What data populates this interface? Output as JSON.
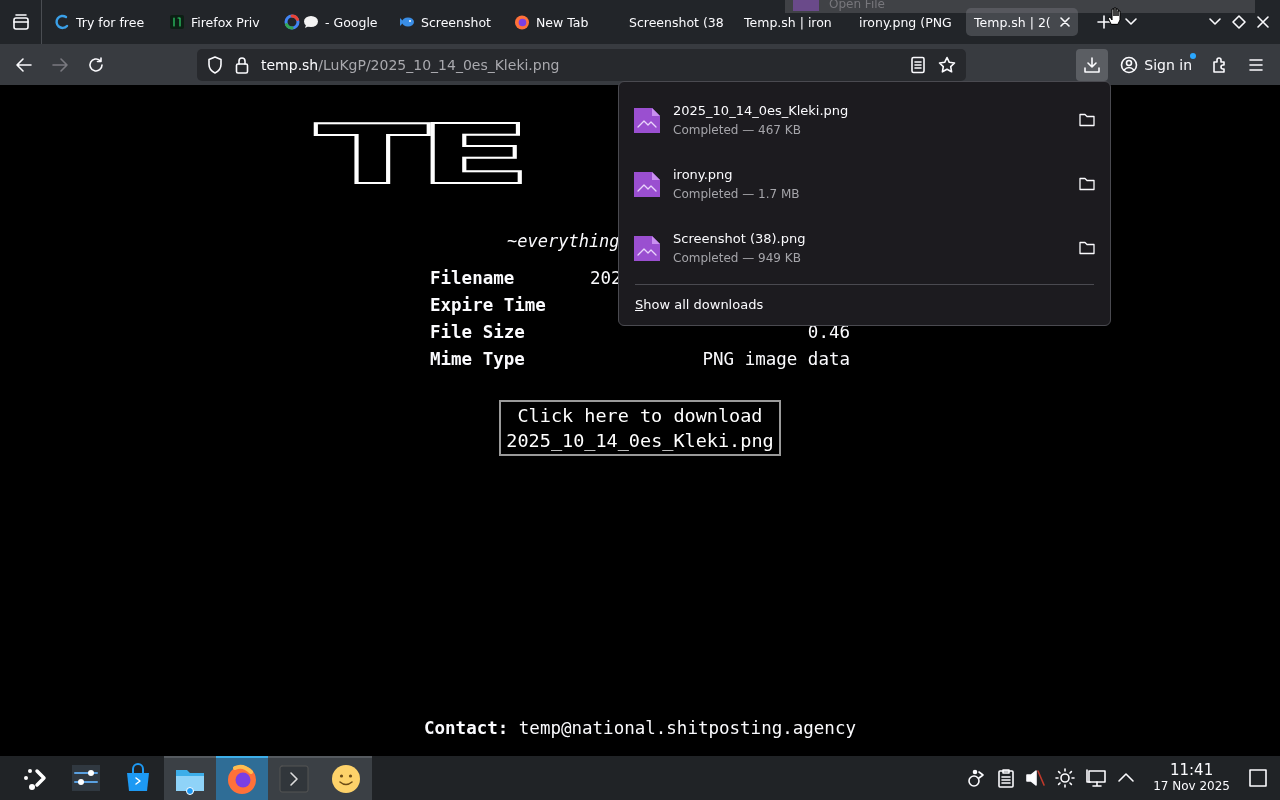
{
  "tab_strip": {
    "tabs": [
      {
        "title": "Try for free",
        "selected": false
      },
      {
        "title": "Firefox Priv",
        "selected": false
      },
      {
        "title": "- Google",
        "selected": false
      },
      {
        "title": "Screenshot",
        "selected": false
      },
      {
        "title": "New Tab",
        "selected": false
      },
      {
        "title": "Screenshot (38",
        "selected": false
      },
      {
        "title": "Temp.sh | iron",
        "selected": false
      },
      {
        "title": "irony.png (PNG",
        "selected": false
      },
      {
        "title": "Temp.sh | 2(",
        "selected": true
      }
    ]
  },
  "drag_ghost": {
    "label": "Open File"
  },
  "toolbar": {
    "forward_disabled": true,
    "url_host": "temp.sh",
    "url_path": "/LuKgP/2025_10_14_0es_Kleki.png",
    "downloads_open": true,
    "sign_in": "Sign in"
  },
  "page": {
    "logo": "TE",
    "tagline": "~everything",
    "rows": [
      {
        "label": "Filename",
        "value": "202"
      },
      {
        "label": "Expire Time",
        "value": ""
      },
      {
        "label": "File Size",
        "value": "0.46"
      },
      {
        "label": "Mime Type",
        "value": "PNG image data"
      }
    ],
    "download_button": [
      "Click here to download",
      "2025_10_14_0es_Kleki.png"
    ],
    "contact": "**Contact:** temp@national.shitposting.agency"
  },
  "downloads_panel": {
    "items": [
      {
        "name": "2025_10_14_0es_Kleki.png",
        "status": "Completed — 467 KB"
      },
      {
        "name": "irony.png",
        "status": "Completed — 1.7 MB"
      },
      {
        "name": "Screenshot (38).png",
        "status": "Completed — 949 KB"
      }
    ],
    "footer": "Show all downloads"
  },
  "taskbar": {
    "tasks": [
      {
        "running": false,
        "selected": false
      },
      {
        "running": false,
        "selected": false
      },
      {
        "running": false,
        "selected": false
      },
      {
        "running": true,
        "selected": false
      },
      {
        "running": true,
        "selected": true
      },
      {
        "running": true,
        "selected": false
      },
      {
        "running": true,
        "selected": false
      }
    ],
    "time": "11:41",
    "date": "17 Nov 2025"
  }
}
